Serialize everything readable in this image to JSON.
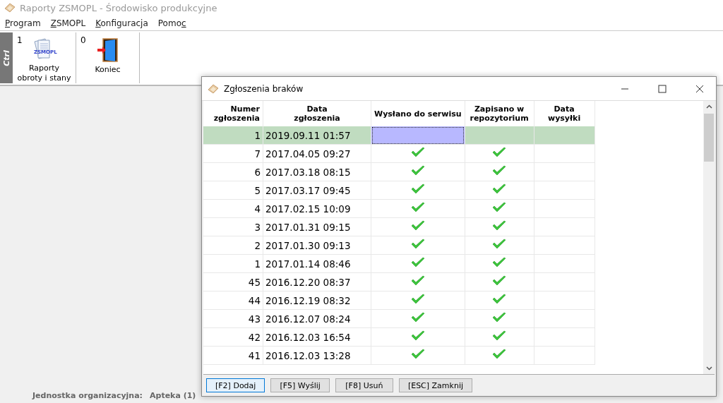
{
  "window": {
    "title": "Raporty ZSMOPL - Środowisko produkcyjne"
  },
  "menu": [
    {
      "access_key": "P",
      "after_key": "rogram"
    },
    {
      "access_key": "Z",
      "after_key": "SMOPL"
    },
    {
      "access_key": "K",
      "after_key": "onfiguracja"
    },
    {
      "before_key": "Pomo",
      "access_key": "c"
    }
  ],
  "toolbar": {
    "group_label": "Ctrl",
    "items": [
      {
        "shortcut": "1",
        "label": "Raporty obroty i stany",
        "kind": "reports",
        "icon_caption": "ZSMOPL"
      },
      {
        "shortcut": "0",
        "label": "Koniec",
        "kind": "exit"
      }
    ]
  },
  "dialog": {
    "title": "Zgłoszenia braków",
    "columns": [
      "Numer zgłoszenia",
      "Data zgłoszenia",
      "Wysłano do serwisu",
      "Zapisano w repozytorium",
      "Data wysyłki"
    ],
    "rows": [
      {
        "number": "1",
        "date": "2019.09.11 01:57",
        "sent": false,
        "saved": false,
        "selected": true,
        "sent_cell_focused": true
      },
      {
        "number": "7",
        "date": "2017.04.05 09:27",
        "sent": true,
        "saved": true,
        "selected": false,
        "sent_cell_focused": false
      },
      {
        "number": "6",
        "date": "2017.03.18 08:15",
        "sent": true,
        "saved": true,
        "selected": false,
        "sent_cell_focused": false
      },
      {
        "number": "5",
        "date": "2017.03.17 09:45",
        "sent": true,
        "saved": true,
        "selected": false,
        "sent_cell_focused": false
      },
      {
        "number": "4",
        "date": "2017.02.15 10:09",
        "sent": true,
        "saved": true,
        "selected": false,
        "sent_cell_focused": false
      },
      {
        "number": "3",
        "date": "2017.01.31 09:15",
        "sent": true,
        "saved": true,
        "selected": false,
        "sent_cell_focused": false
      },
      {
        "number": "2",
        "date": "2017.01.30 09:13",
        "sent": true,
        "saved": true,
        "selected": false,
        "sent_cell_focused": false
      },
      {
        "number": "1",
        "date": "2017.01.14 08:46",
        "sent": true,
        "saved": true,
        "selected": false,
        "sent_cell_focused": false
      },
      {
        "number": "45",
        "date": "2016.12.20 08:37",
        "sent": true,
        "saved": true,
        "selected": false,
        "sent_cell_focused": false
      },
      {
        "number": "44",
        "date": "2016.12.19 08:32",
        "sent": true,
        "saved": true,
        "selected": false,
        "sent_cell_focused": false
      },
      {
        "number": "43",
        "date": "2016.12.07 08:24",
        "sent": true,
        "saved": true,
        "selected": false,
        "sent_cell_focused": false
      },
      {
        "number": "42",
        "date": "2016.12.03 16:54",
        "sent": true,
        "saved": true,
        "selected": false,
        "sent_cell_focused": false
      },
      {
        "number": "41",
        "date": "2016.12.03 13:28",
        "sent": true,
        "saved": true,
        "selected": false,
        "sent_cell_focused": false
      }
    ],
    "buttons": [
      {
        "label": "[F2] Dodaj",
        "default": true
      },
      {
        "label": "[F5] Wyślij",
        "default": false
      },
      {
        "label": "[F8] Usuń",
        "default": false
      },
      {
        "label": "[ESC] Zamknij",
        "default": false
      }
    ]
  },
  "status": {
    "label": "Jednostka organizacyjna:",
    "value": "Apteka (1)"
  }
}
